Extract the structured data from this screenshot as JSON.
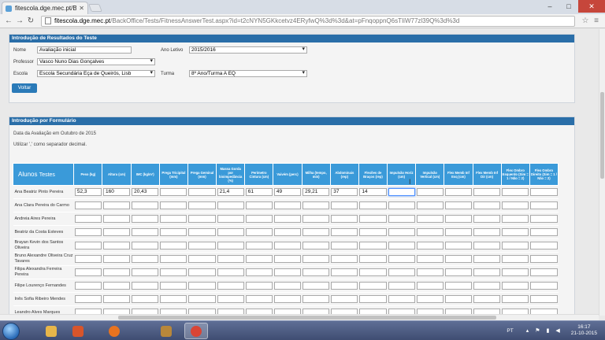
{
  "browser": {
    "tab_title": "fitescola.dge.mec.pt/Back",
    "url_host": "fitescola.dge.mec.pt",
    "url_path": "/BackOffice/Tests/FitnessAnswerTest.aspx?id=t2cNYN5GKkcetvz4ERyfwQ%3d%3d&at=pFnqoppnQ6sTIiW77zl39Q%3d%3d"
  },
  "panel_results": {
    "title": "Introdução de Resultados do Teste",
    "nome_label": "Nome",
    "nome_value": "Avaliação inicial",
    "ano_letivo_label": "Ano Letivo",
    "ano_letivo_value": "2015/2016",
    "professor_label": "Professor",
    "professor_value": "Vasco Nuno Dias Gonçalves",
    "escola_label": "Escola",
    "escola_value": "Escola Secundária Eça de Queirós, Lisb",
    "turma_label": "Turma",
    "turma_value": "8º Ano/Turma A EQ",
    "voltar_label": "Voltar"
  },
  "panel_form": {
    "title": "Introdução por Formulário",
    "date_note": "Data da Avaliação em Outubro de 2015",
    "decimal_note": "Utilizar ',' como separador decimal."
  },
  "grid": {
    "corner_label_a": "Alunos",
    "corner_label_b": "Testes",
    "columns": [
      "Peso (kg)",
      "Altura (cm)",
      "IMC (kg/m²)",
      "Prega Tricipital (mm)",
      "Prega Geminal (mm)",
      "Massa Gorda por bioimpedância (%)",
      "Perímetro Cintura (cm)",
      "Vaivém (perc)",
      "Milha (tempo, min)",
      "Abdominais (rep)",
      "Flexões de Braços (rep)",
      "Impulsão Horiz (cm)",
      "Impulsão Vertical (cm)",
      "Flex Memb Inf Esq (cm)",
      "Flex Memb Inf Dir (cm)",
      "Flex Ombro Esquerdo (Sim = 1 / Não = 2)",
      "Flex Ombro Direito (Sim = 1 / Não = 2)"
    ],
    "rows": [
      {
        "name": "Ana Beatriz Pinto Pereira",
        "values": [
          "52,3",
          "160",
          "20,43",
          "",
          "",
          "21,4",
          "61",
          "49",
          "29,21",
          "37",
          "14",
          "",
          "",
          "",
          "",
          "",
          ""
        ]
      },
      {
        "name": "Ana Clara Pereira do Carmo",
        "values": [
          "",
          "",
          "",
          "",
          "",
          "",
          "",
          "",
          "",
          "",
          "",
          "",
          "",
          "",
          "",
          "",
          ""
        ]
      },
      {
        "name": "Andreia Aires Pereira",
        "values": [
          "",
          "",
          "",
          "",
          "",
          "",
          "",
          "",
          "",
          "",
          "",
          "",
          "",
          "",
          "",
          "",
          ""
        ]
      },
      {
        "name": "Beatriz da Costa Esteves",
        "values": [
          "",
          "",
          "",
          "",
          "",
          "",
          "",
          "",
          "",
          "",
          "",
          "",
          "",
          "",
          "",
          "",
          ""
        ]
      },
      {
        "name": "Brayan Kevin dos Santos Oliveira",
        "values": [
          "",
          "",
          "",
          "",
          "",
          "",
          "",
          "",
          "",
          "",
          "",
          "",
          "",
          "",
          "",
          "",
          ""
        ]
      },
      {
        "name": "Bruno Alexandre Oliveira Cruz Tavares",
        "values": [
          "",
          "",
          "",
          "",
          "",
          "",
          "",
          "",
          "",
          "",
          "",
          "",
          "",
          "",
          "",
          "",
          ""
        ]
      },
      {
        "name": "Filipa Alexandra Ferreira Pereira",
        "values": [
          "",
          "",
          "",
          "",
          "",
          "",
          "",
          "",
          "",
          "",
          "",
          "",
          "",
          "",
          "",
          "",
          ""
        ]
      },
      {
        "name": "Filipe Lourenço Fernandes",
        "values": [
          "",
          "",
          "",
          "",
          "",
          "",
          "",
          "",
          "",
          "",
          "",
          "",
          "",
          "",
          "",
          "",
          ""
        ]
      },
      {
        "name": "Inês Sofia Ribeiro Mendes",
        "values": [
          "",
          "",
          "",
          "",
          "",
          "",
          "",
          "",
          "",
          "",
          "",
          "",
          "",
          "",
          "",
          "",
          ""
        ]
      },
      {
        "name": "Leandro Alves Marques",
        "values": [
          "",
          "",
          "",
          "",
          "",
          "",
          "",
          "",
          "",
          "",
          "",
          "",
          "",
          "",
          "",
          "",
          ""
        ]
      }
    ]
  },
  "taskbar": {
    "lang": "PT",
    "time": "16:17",
    "date": "21-10-2015",
    "icons": [
      {
        "name": "explorer-icon",
        "color": "#e7b64a"
      },
      {
        "name": "powerpoint-icon",
        "color": "#d8552b"
      },
      {
        "name": "firefox-icon",
        "color": "#e8731f"
      },
      {
        "name": "archive-icon",
        "color": "#b8873a"
      },
      {
        "name": "chrome-icon",
        "color": "#d94535"
      }
    ]
  },
  "colors": {
    "header_blue": "#2a6ea8",
    "grid_header_blue": "#3a9ad9",
    "button_blue": "#2a7ab8"
  }
}
